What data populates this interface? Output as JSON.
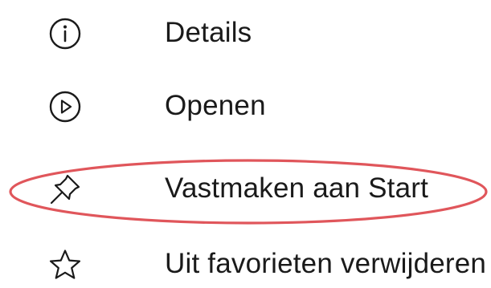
{
  "menu": {
    "items": [
      {
        "label": "Details",
        "icon": "info-icon"
      },
      {
        "label": "Openen",
        "icon": "play-icon"
      },
      {
        "label": "Vastmaken aan Start",
        "icon": "pin-icon"
      },
      {
        "label": "Uit favorieten verwijderen",
        "icon": "star-icon"
      }
    ]
  },
  "highlight": {
    "target": "Vastmaken aan Start",
    "color": "#e0565b"
  }
}
